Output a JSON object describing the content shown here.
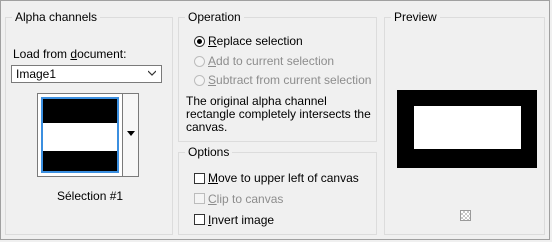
{
  "alpha_channels": {
    "title": "Alpha channels",
    "load_label_pre": "Load from ",
    "load_label_u": "d",
    "load_label_post": "ocument:",
    "dropdown_value": "Image1",
    "selection_name": "Sélection #1"
  },
  "operation": {
    "title": "Operation",
    "options": [
      {
        "label_u": "R",
        "label_rest": "eplace selection",
        "checked": true,
        "enabled": true
      },
      {
        "label_u": "A",
        "label_rest": "dd to current selection",
        "checked": false,
        "enabled": false
      },
      {
        "label_u": "S",
        "label_rest": "ubtract from current selection",
        "checked": false,
        "enabled": false
      }
    ],
    "description_lines": [
      "The original alpha channel",
      "rectangle completely intersects the",
      "canvas."
    ]
  },
  "options": {
    "title": "Options",
    "items": [
      {
        "label_u": "M",
        "label_rest": "ove to upper left of canvas",
        "checked": false,
        "enabled": true
      },
      {
        "label_u": "C",
        "label_rest": "lip to canvas",
        "checked": false,
        "enabled": false
      },
      {
        "label_u": "I",
        "label_rest": "nvert image",
        "checked": false,
        "enabled": true
      }
    ]
  },
  "preview": {
    "title": "Preview",
    "transparency_icon": "checkerboard-icon"
  }
}
